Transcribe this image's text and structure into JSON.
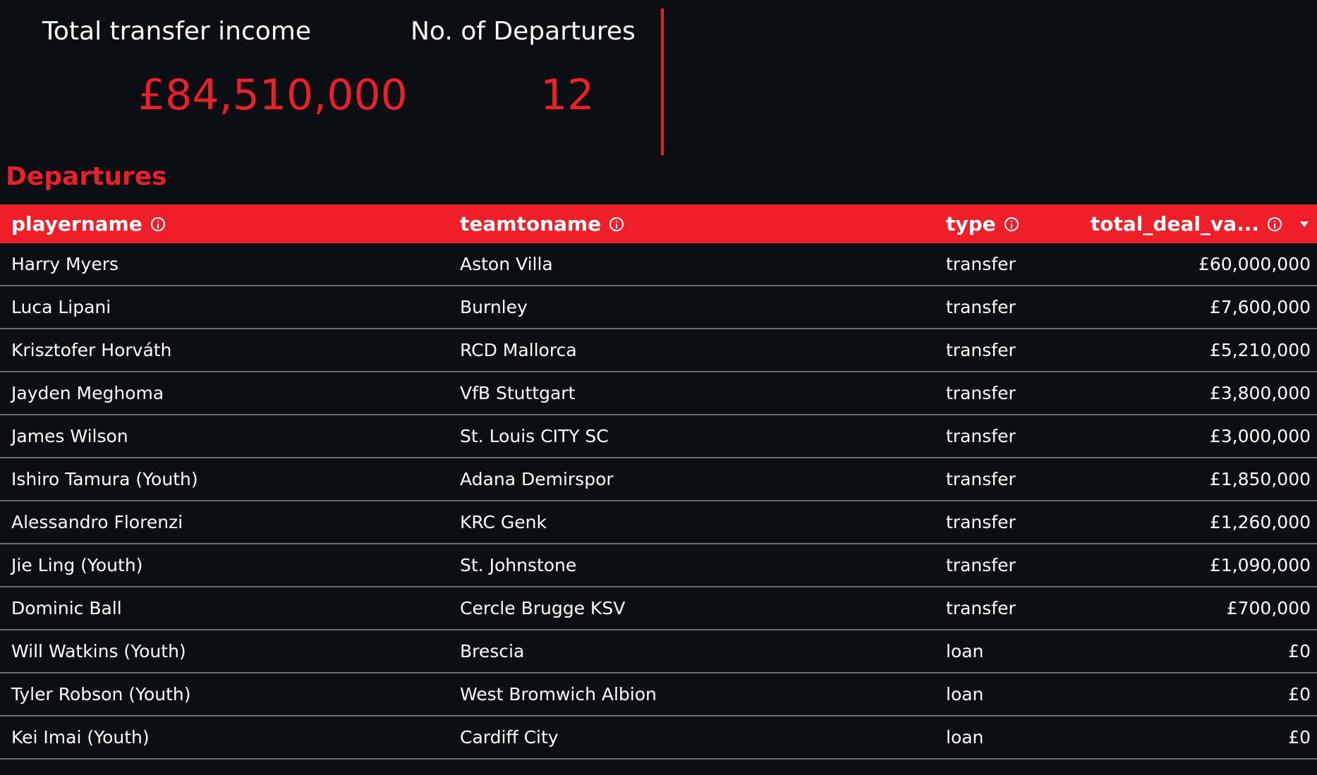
{
  "scorecards": {
    "income": {
      "label": "Total transfer income",
      "value": "£84,510,000"
    },
    "departures": {
      "label": "No. of Departures",
      "value": "12"
    }
  },
  "section_title": "Departures",
  "table": {
    "headers": {
      "playername": "playername",
      "teamtoname": "teamtoname",
      "type": "type",
      "total_deal_value": "total_deal_va..."
    },
    "rows": [
      {
        "playername": "Harry Myers",
        "teamtoname": "Aston Villa",
        "type": "transfer",
        "value": "£60,000,000"
      },
      {
        "playername": "Luca Lipani",
        "teamtoname": "Burnley",
        "type": "transfer",
        "value": "£7,600,000"
      },
      {
        "playername": "Krisztofer Horváth",
        "teamtoname": "RCD Mallorca",
        "type": "transfer",
        "value": "£5,210,000"
      },
      {
        "playername": "Jayden Meghoma",
        "teamtoname": "VfB Stuttgart",
        "type": "transfer",
        "value": "£3,800,000"
      },
      {
        "playername": "James Wilson",
        "teamtoname": "St. Louis CITY SC",
        "type": "transfer",
        "value": "£3,000,000"
      },
      {
        "playername": "Ishiro Tamura (Youth)",
        "teamtoname": "Adana Demirspor",
        "type": "transfer",
        "value": "£1,850,000"
      },
      {
        "playername": "Alessandro Florenzi",
        "teamtoname": "KRC Genk",
        "type": "transfer",
        "value": "£1,260,000"
      },
      {
        "playername": "Jie Ling (Youth)",
        "teamtoname": "St. Johnstone",
        "type": "transfer",
        "value": "£1,090,000"
      },
      {
        "playername": "Dominic Ball",
        "teamtoname": "Cercle Brugge KSV",
        "type": "transfer",
        "value": "£700,000"
      },
      {
        "playername": "Will Watkins (Youth)",
        "teamtoname": "Brescia",
        "type": "loan",
        "value": "£0"
      },
      {
        "playername": "Tyler Robson (Youth)",
        "teamtoname": "West Bromwich Albion",
        "type": "loan",
        "value": "£0"
      },
      {
        "playername": "Kei Imai (Youth)",
        "teamtoname": "Cardiff City",
        "type": "loan",
        "value": "£0"
      }
    ]
  },
  "colors": {
    "background": "#0b0e13",
    "accent": "#e8202a",
    "header_bg": "#ee1f29",
    "row_divider": "#6a6d72"
  },
  "icons": {
    "header_info": "info-icon",
    "sort": "sort-descending-icon"
  }
}
